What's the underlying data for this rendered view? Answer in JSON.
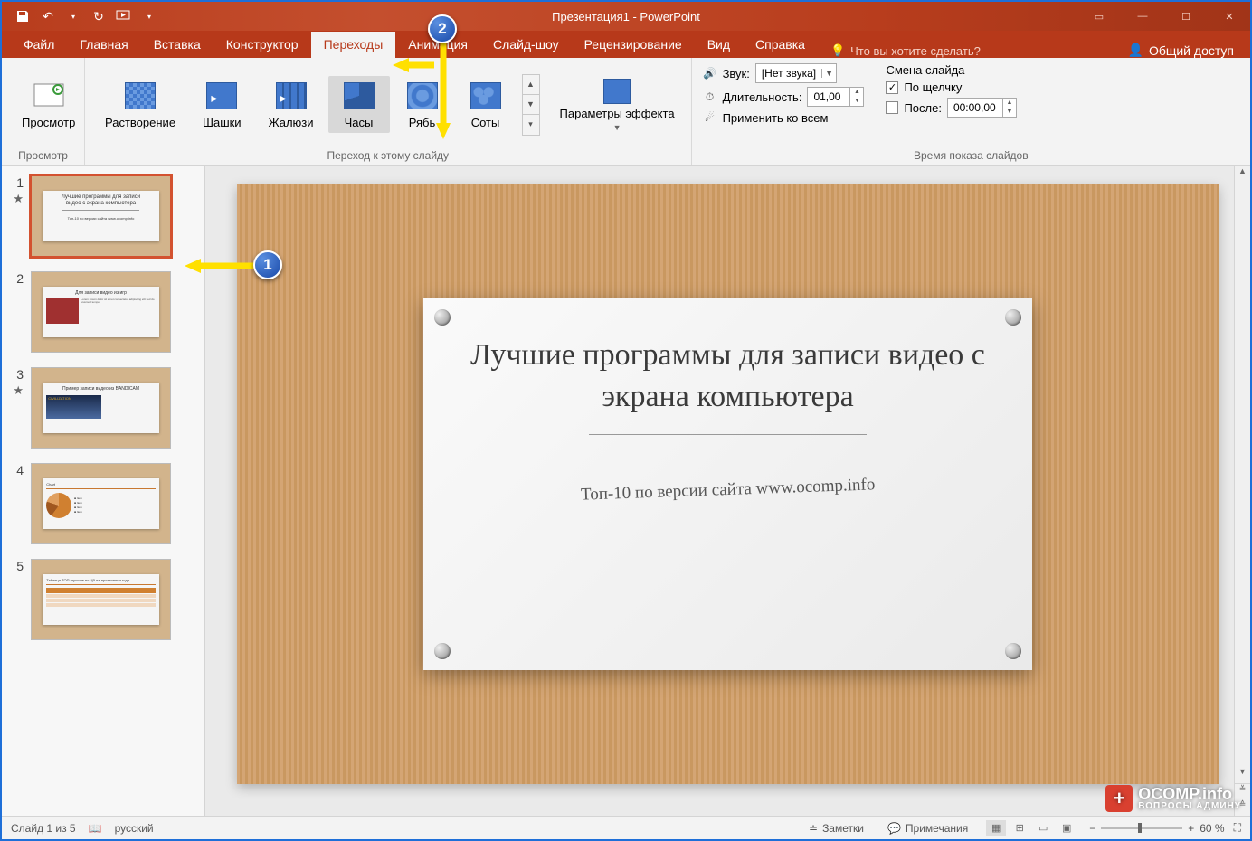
{
  "titlebar": {
    "title": "Презентация1 - PowerPoint"
  },
  "tabs": {
    "file": "Файл",
    "home": "Главная",
    "insert": "Вставка",
    "design": "Конструктор",
    "transitions": "Переходы",
    "animations": "Анимация",
    "slideshow": "Слайд-шоу",
    "review": "Рецензирование",
    "view": "Вид",
    "help": "Справка",
    "tellme": "Что вы хотите сделать?",
    "share": "Общий доступ"
  },
  "ribbon": {
    "preview_group": "Просмотр",
    "preview_btn": "Просмотр",
    "transition_group": "Переход к этому слайду",
    "transitions": {
      "dissolve": "Растворение",
      "checker": "Шашки",
      "blinds": "Жалюзи",
      "clock": "Часы",
      "ripple": "Рябь",
      "honeycomb": "Соты"
    },
    "effect_options": "Параметры эффекта",
    "timing_group": "Время показа слайдов",
    "sound_label": "Звук:",
    "sound_value": "[Нет звука]",
    "duration_label": "Длительность:",
    "duration_value": "01,00",
    "apply_all": "Применить ко всем",
    "advance_title": "Смена слайда",
    "on_click": "По щелчку",
    "after_label": "После:",
    "after_value": "00:00,00"
  },
  "slide": {
    "title": "Лучшие программы для записи видео с экрана компьютера",
    "subtitle": "Топ-10 по версии сайта www.ocomp.info"
  },
  "thumbs": {
    "t2_title": "Для записи видео из игр",
    "t3_title": "Пример записи видео из BANDICAM"
  },
  "statusbar": {
    "slide_info": "Слайд 1 из 5",
    "language": "русский",
    "notes": "Заметки",
    "comments": "Примечания",
    "zoom": "60 %"
  },
  "callouts": {
    "c1": "1",
    "c2": "2"
  },
  "watermark": {
    "brand": "OCOMP.info",
    "tagline": "ВОПРОСЫ АДМИНУ"
  }
}
